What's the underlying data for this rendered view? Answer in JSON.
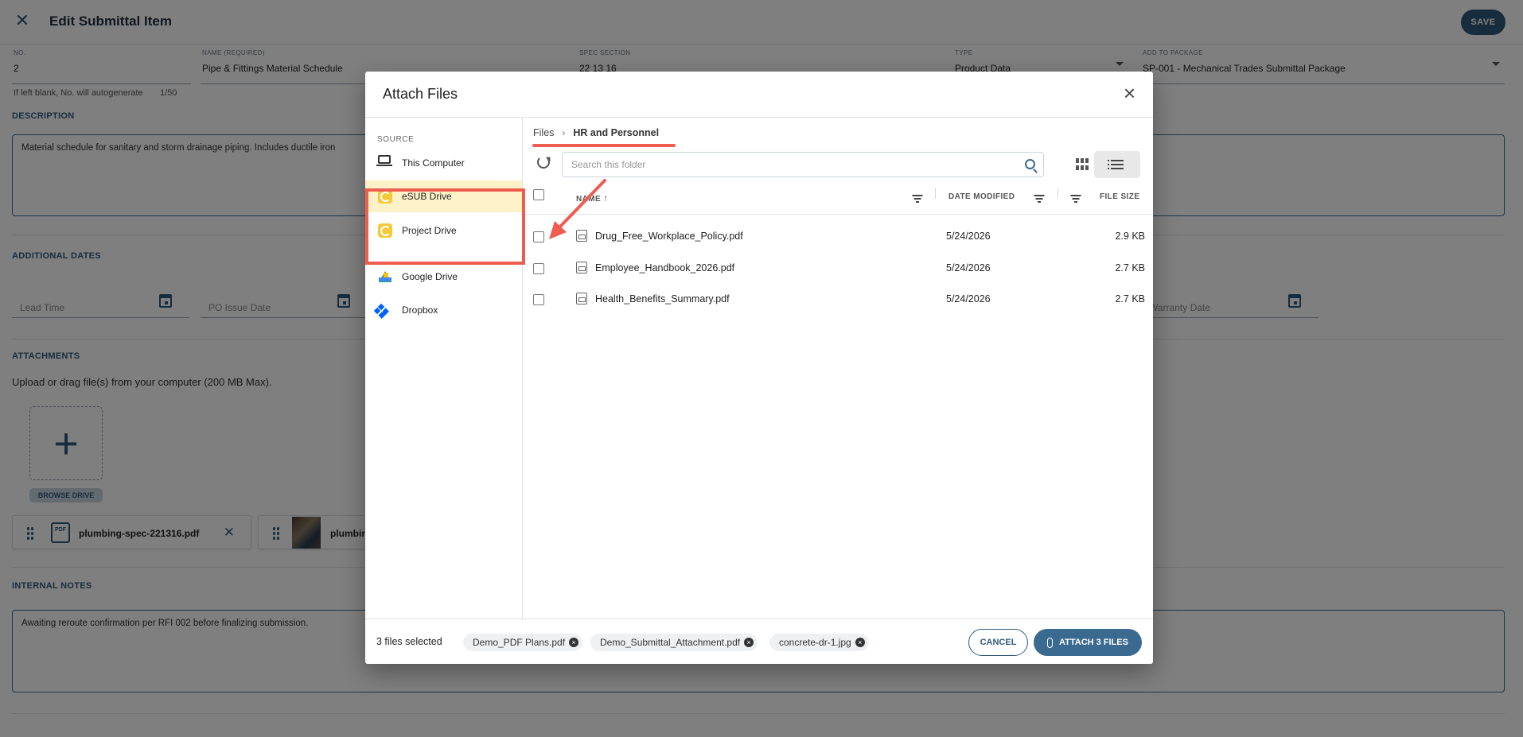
{
  "page": {
    "title": "Edit Submittal Item",
    "save_label": "SAVE",
    "fields": {
      "no": {
        "label": "NO.",
        "value": "2"
      },
      "name": {
        "label": "NAME (REQUIRED)",
        "value": "Pipe & Fittings Material Schedule"
      },
      "spec": {
        "label": "SPEC SECTION",
        "value": "22 13 16"
      },
      "type": {
        "label": "TYPE",
        "value": "Product Data"
      },
      "package": {
        "label": "ADD TO PACKAGE",
        "value": "SP-001 - Mechanical Trades Submittal Package"
      }
    },
    "no_hint": "If left blank, No. will autogenerate",
    "name_counter": "1/50",
    "description": {
      "heading": "DESCRIPTION",
      "text": "Material schedule for sanitary and storm drainage piping. Includes ductile iron"
    },
    "additional_dates": {
      "heading": "ADDITIONAL DATES",
      "lead_time": "Lead Time",
      "po_issue_date": "PO Issue Date",
      "warranty_date": "Warranty Date"
    },
    "attachments": {
      "heading": "ATTACHMENTS",
      "hint": "Upload or drag file(s) from your computer (200 MB Max).",
      "browse_label": "BROWSE DRIVE",
      "pdf_badge": "PDF",
      "files": [
        "plumbing-spec-221316.pdf",
        "plumbin"
      ]
    },
    "internal_notes": {
      "heading": "INTERNAL NOTES",
      "text": "Awaiting reroute confirmation per RFI 002 before finalizing submission."
    }
  },
  "dialog": {
    "title": "Attach Files",
    "source_label": "SOURCE",
    "sources": [
      {
        "label": "This Computer",
        "icon": "laptop-icon"
      },
      {
        "label": "eSUB Drive",
        "icon": "esub-icon",
        "active": true
      },
      {
        "label": "Project Drive",
        "icon": "esub-icon"
      },
      {
        "label": "Google Drive",
        "icon": "google-drive-icon"
      },
      {
        "label": "Dropbox",
        "icon": "dropbox-icon"
      }
    ],
    "breadcrumb": {
      "root": "Files",
      "current": "HR and Personnel"
    },
    "search_placeholder": "Search this folder",
    "columns": {
      "name": "NAME",
      "date": "DATE MODIFIED",
      "size": "FILE SIZE"
    },
    "files": [
      {
        "name": "Drug_Free_Workplace_Policy.pdf",
        "date": "5/24/2026",
        "size": "2.9 KB"
      },
      {
        "name": "Employee_Handbook_2026.pdf",
        "date": "5/24/2026",
        "size": "2.7 KB"
      },
      {
        "name": "Health_Benefits_Summary.pdf",
        "date": "5/24/2026",
        "size": "2.7 KB"
      }
    ],
    "footer": {
      "selected_text": "3 files selected",
      "chips": [
        "Demo_PDF Plans.pdf",
        "Demo_Submittal_Attachment.pdf",
        "concrete-dr-1.jpg"
      ],
      "cancel_label": "CANCEL",
      "attach_label": "ATTACH 3 FILES"
    }
  },
  "colors": {
    "accent": "#2f5a7d",
    "highlight": "#ee5d50",
    "active_source_bg": "#fdf1c8"
  }
}
